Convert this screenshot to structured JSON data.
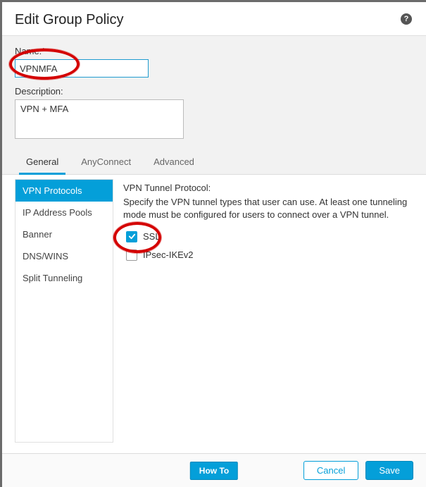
{
  "header": {
    "title": "Edit Group Policy",
    "help_icon": "?"
  },
  "form": {
    "name_label": "Name:*",
    "name_value": "VPNMFA",
    "desc_label": "Description:",
    "desc_value": "VPN + MFA"
  },
  "tabs": [
    {
      "label": "General"
    },
    {
      "label": "AnyConnect"
    },
    {
      "label": "Advanced"
    }
  ],
  "sidebar": {
    "items": [
      {
        "label": "VPN Protocols"
      },
      {
        "label": "IP Address Pools"
      },
      {
        "label": "Banner"
      },
      {
        "label": "DNS/WINS"
      },
      {
        "label": "Split Tunneling"
      }
    ]
  },
  "protocols": {
    "title": "VPN Tunnel Protocol:",
    "desc": "Specify the VPN tunnel types that user can use. At least one tunneling mode must be configured for users to connect over a VPN tunnel.",
    "options": [
      {
        "label": "SSL"
      },
      {
        "label": "IPsec-IKEv2"
      }
    ]
  },
  "footer": {
    "howto": "How To",
    "cancel": "Cancel",
    "save": "Save"
  }
}
